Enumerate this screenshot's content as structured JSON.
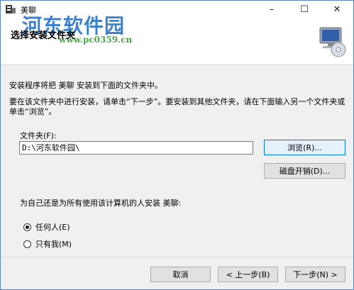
{
  "window": {
    "title": "美聊",
    "app_icon": "installer-app-icon",
    "controls": {
      "minimize": "–",
      "maximize": "☐",
      "close": "✕"
    }
  },
  "header": {
    "title": "选择安装文件夹",
    "watermark_text": "河东软件园",
    "watermark_url": "www.pc0359.cn",
    "image": "computer-cd-icon"
  },
  "content": {
    "line1": "安装程序将把 美聊 安装到下面的文件夹中。",
    "line2": "要在该文件夹中进行安装，请单击“下一步”。要安装到其他文件夹，请在下面输入另一个文件夹或单击“浏览”。",
    "folder_label": "文件夹(F):",
    "folder_value": "D:\\河东软件园\\",
    "browse_label": "浏览(R)...",
    "diskcost_label": "磁盘开销(D)...",
    "install_for_label": "为自己还是为所有使用该计算机的人安装 美聊:",
    "radio_everyone": "任何人(E)",
    "radio_justme": "只有我(M)",
    "selected": "everyone"
  },
  "footer": {
    "cancel_label": "取消",
    "back_label": "< 上一步(B)",
    "next_label": "下一步(N) >"
  },
  "colors": {
    "accent": "#0078d7",
    "watermark_blue": "#2e78c8",
    "watermark_green": "#3a9a3a"
  }
}
